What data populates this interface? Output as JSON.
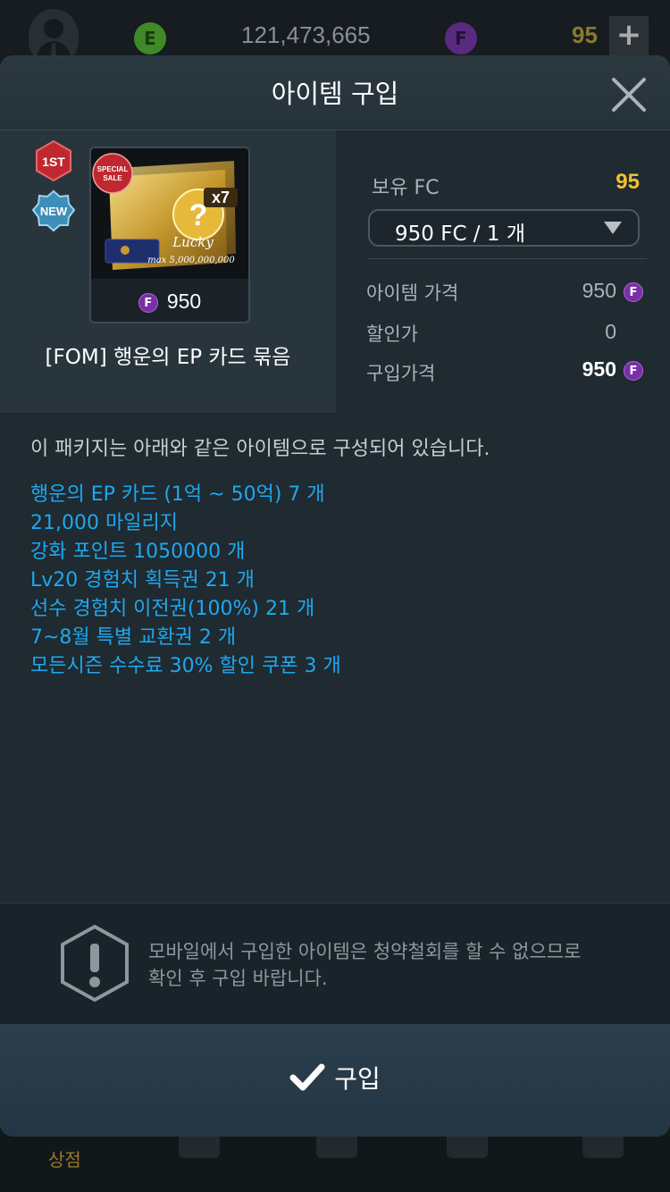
{
  "background": {
    "ep_amount": "121,473,665",
    "ep_coin_letter": "E",
    "fc_coin_letter": "F",
    "fc_amount": "95",
    "plus_label": "+",
    "nav_shop_label": "상점"
  },
  "modal": {
    "title": "아이템 구입"
  },
  "product": {
    "rank_badge": "1ST",
    "new_badge": "NEW",
    "sale_tag": "SPECIAL SALE",
    "multiplier": "x7",
    "card_text": "Lucky",
    "card_max": "max 5,000,000,000",
    "price": "950",
    "currency_letter": "F",
    "name": "[FOM] 행운의 EP 카드 묶음"
  },
  "purchase": {
    "owned_label": "보유 FC",
    "owned_value": "95",
    "quantity_selected": "950 FC / 1 개",
    "item_price_label": "아이템 가격",
    "item_price_value": "950",
    "discount_label": "할인가",
    "discount_value": "0",
    "total_label": "구입가격",
    "total_value": "950"
  },
  "description": {
    "intro": "이 패키지는 아래와 같은 아이템으로 구성되어 있습니다.",
    "items": [
      "행운의 EP 카드 (1억 ~ 50억) 7 개",
      "21,000 마일리지",
      "강화 포인트 1050000 개",
      "Lv20 경험치 획득권 21 개",
      "선수 경험치 이전권(100%) 21 개",
      "7~8월 특별 교환권 2 개",
      "모든시즌 수수료 30% 할인 쿠폰 3 개"
    ]
  },
  "notice": {
    "line1": "모바일에서 구입한 아이템은 청약철회를 할 수 없으므로",
    "line2": "확인 후 구입 바랍니다."
  },
  "buy_button": {
    "label": "구입"
  },
  "colors": {
    "accent_blue": "#1ea8ee",
    "gold": "#f2c22b",
    "f_coin": "#7b2fa6",
    "badge_red": "#c0282f",
    "badge_blue": "#3d8fb8"
  }
}
